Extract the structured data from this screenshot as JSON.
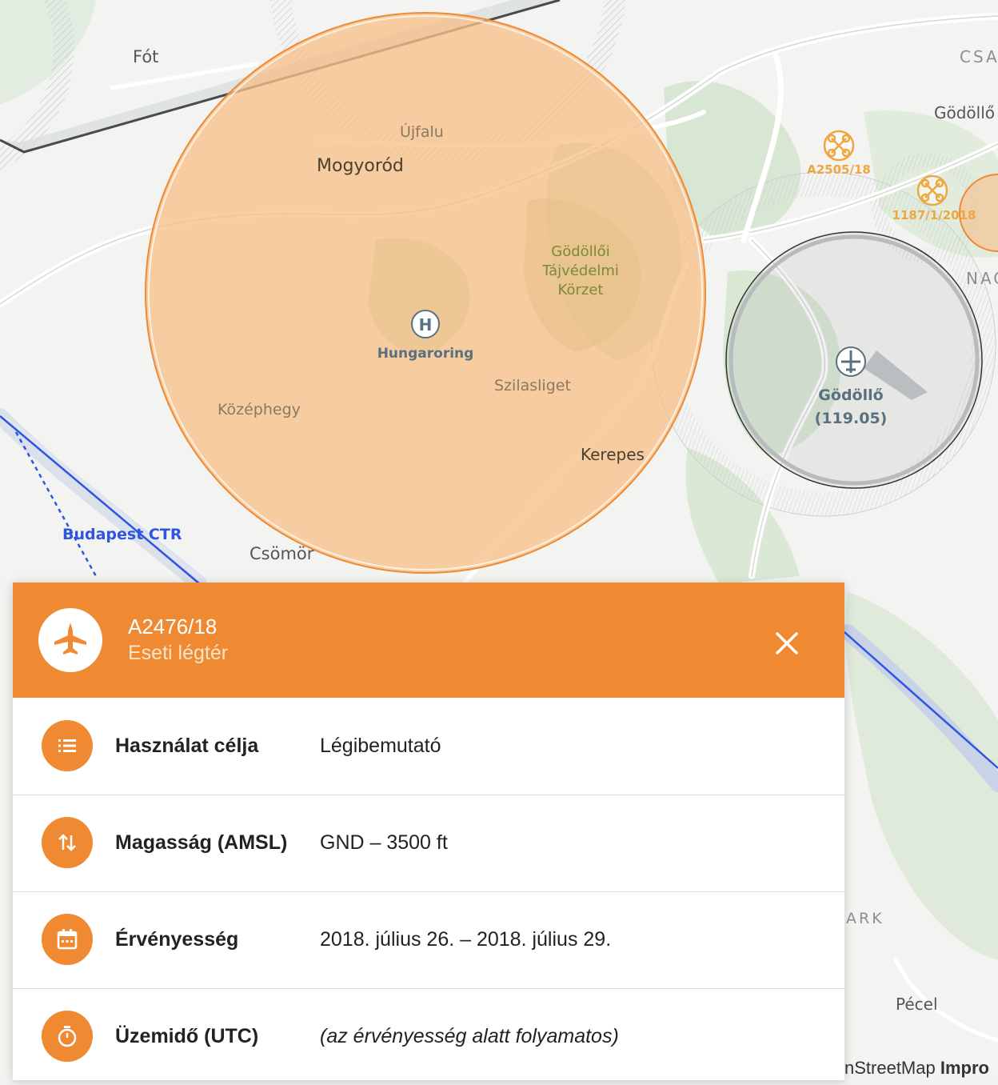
{
  "map": {
    "labels": {
      "fot": "Fót",
      "csa": "CSA",
      "godollo_top": "Gödöllő",
      "ujfalu": "Újfalu",
      "mogyorod": "Mogyoród",
      "tajvedelmi_1": "Gödöllői",
      "tajvedelmi_2": "Tájvédelmi",
      "tajvedelmi_3": "Körzet",
      "hungaroring": "Hungaroring",
      "szilasliget": "Szilasliget",
      "kozephegy": "Középhegy",
      "kerepes": "Kerepes",
      "budapest_ctr": "Budapest CTR",
      "csomor": "Csömör",
      "nac": "NAC",
      "park": "ARK",
      "pecel": "Pécel",
      "airfield_name": "Gödöllő",
      "airfield_freq": "(119.05)",
      "drone_a": "A2505/18",
      "drone_b": "1187/1/2018"
    },
    "colors": {
      "zone_fill": "#f6c089",
      "zone_stroke": "#ef8a33",
      "ctr_line": "#2f55e0",
      "drone": "#f0a640"
    }
  },
  "panel": {
    "header": {
      "id": "A2476/18",
      "type": "Eseti légtér",
      "icon": "fighter-jet-icon",
      "close_icon": "close-icon",
      "color": "#ef8a33"
    },
    "rows": [
      {
        "label": "Használat célja",
        "value": "Légibemutató",
        "icon": "list-icon"
      },
      {
        "label": "Magasság (AMSL)",
        "value": "GND – 3500 ft",
        "icon": "altitude-arrows-icon"
      },
      {
        "label": "Érvényesség",
        "value": "2018. július 26. – 2018. július 29.",
        "icon": "calendar-icon"
      },
      {
        "label": "Üzemidő (UTC)",
        "value": "(az érvényesség alatt folyamatos)",
        "icon": "timer-icon"
      }
    ]
  },
  "attribution": {
    "osm": "nStreetMap",
    "improve": "Impro"
  }
}
